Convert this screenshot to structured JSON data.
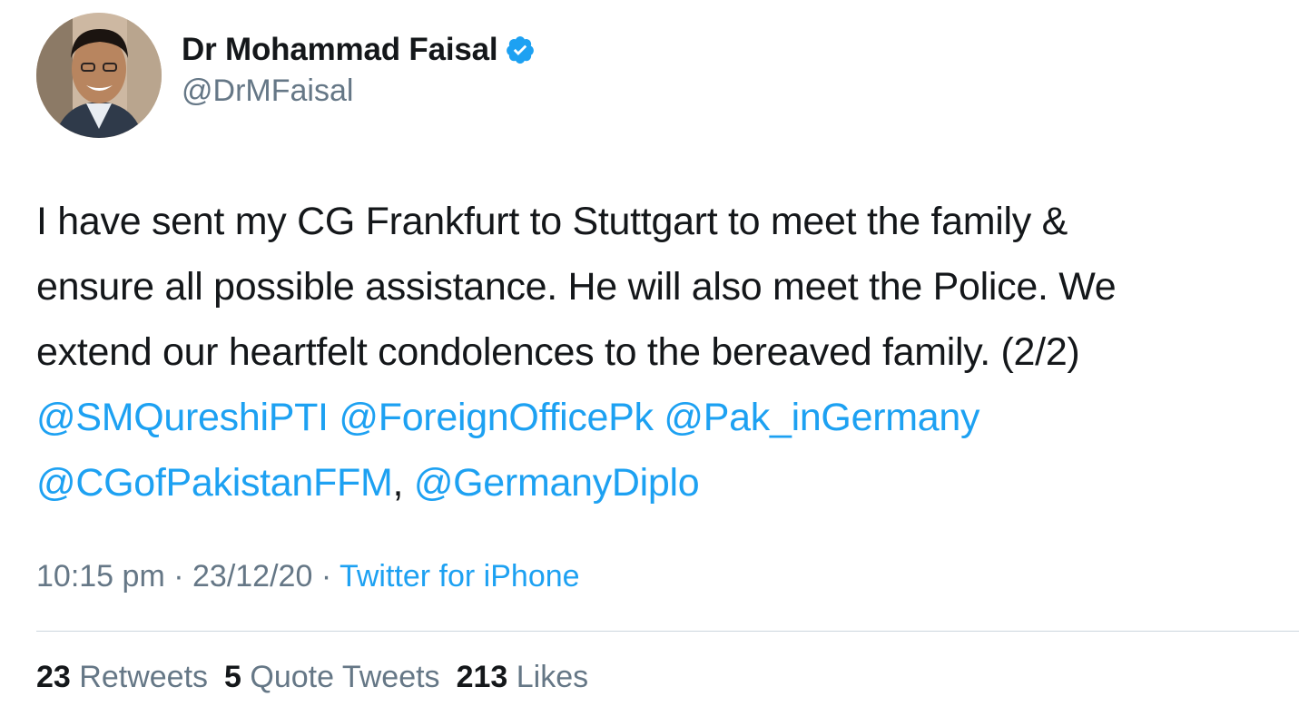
{
  "author": {
    "display_name": "Dr Mohammad Faisal",
    "handle": "@DrMFaisal",
    "verified": true
  },
  "tweet": {
    "text_lines": [
      "I have sent my CG Frankfurt to Stuttgart to meet the family &",
      "ensure all possible assistance. He will also meet the Police. We",
      "extend our heartfelt condolences to the bereaved family. (2/2)"
    ],
    "mentions_line1": [
      "@SMQureshiPTI",
      "@ForeignOfficePk",
      "@Pak_inGermany"
    ],
    "mentions_line2": [
      "@CGofPakistanFFM",
      "@GermanyDiplo"
    ],
    "mentions_separator": ","
  },
  "meta": {
    "time": "10:15 pm",
    "separator": "·",
    "date": "23/12/20",
    "source": "Twitter for iPhone"
  },
  "stats": {
    "retweets_count": "23",
    "retweets_label": "Retweets",
    "quotes_count": "5",
    "quotes_label": "Quote Tweets",
    "likes_count": "213",
    "likes_label": "Likes"
  },
  "colors": {
    "link": "#1da1f2",
    "secondary_text": "#657786",
    "primary_text": "#14171a",
    "divider": "#ccd6dd"
  }
}
